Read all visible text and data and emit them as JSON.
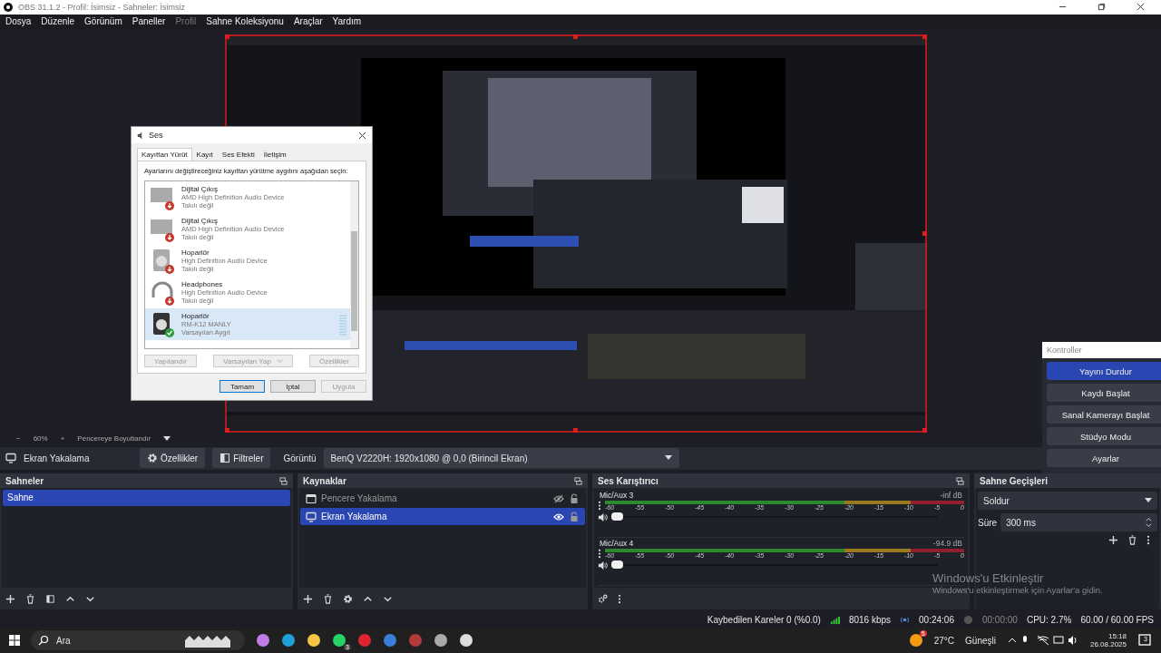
{
  "window": {
    "title": "OBS 31.1.2 - Profil: İsimsiz - Sahneler: İsimsiz"
  },
  "menu": [
    {
      "label": "Dosya",
      "disabled": false
    },
    {
      "label": "Düzenle",
      "disabled": false
    },
    {
      "label": "Görünüm",
      "disabled": false
    },
    {
      "label": "Paneller",
      "disabled": false
    },
    {
      "label": "Profil",
      "disabled": true
    },
    {
      "label": "Sahne Koleksiyonu",
      "disabled": false
    },
    {
      "label": "Araçlar",
      "disabled": false
    },
    {
      "label": "Yardım",
      "disabled": false
    }
  ],
  "zoom_bar": {
    "minus": "−",
    "zoom": "60%",
    "plus": "+",
    "fit": "Pencereye Boyutlandır"
  },
  "source_toolbar": {
    "source": "Ekran Yakalama",
    "properties": "Özellikler",
    "filters": "Filtreler",
    "display_label": "Görüntü",
    "display": "BenQ V2220H: 1920x1080 @ 0,0 (Birincil Ekran)"
  },
  "scenes": {
    "title": "Sahneler",
    "items": [
      {
        "name": "Sahne",
        "selected": true
      }
    ]
  },
  "sources": {
    "title": "Kaynaklar",
    "items": [
      {
        "name": "Pencere Yakalama",
        "kind": "window",
        "selected": false,
        "visible": false
      },
      {
        "name": "Ekran Yakalama",
        "kind": "display",
        "selected": true,
        "visible": true
      }
    ]
  },
  "mixer": {
    "title": "Ses Karıştırıcı",
    "channels": [
      {
        "name": "Mic/Aux 3",
        "reading": "-inf dB",
        "level": 0,
        "scale": [
          "-60",
          "-55",
          "-50",
          "-45",
          "-40",
          "-35",
          "-30",
          "-25",
          "-20",
          "-15",
          "-10",
          "-5",
          "0"
        ]
      },
      {
        "name": "Mic/Aux 4",
        "reading": "-94.9 dB",
        "level": 0,
        "scale": [
          "-60",
          "-55",
          "-50",
          "-45",
          "-40",
          "-35",
          "-30",
          "-25",
          "-20",
          "-15",
          "-10",
          "-5",
          "0"
        ]
      }
    ]
  },
  "transitions": {
    "title": "Sahne Geçişleri",
    "transition": "Soldur",
    "duration_label": "Süre",
    "duration": "300 ms"
  },
  "controls": {
    "title": "Kontroller",
    "buttons": [
      {
        "label": "Yayını Durdur",
        "active": true
      },
      {
        "label": "Kaydı Başlat",
        "active": false
      },
      {
        "label": "Sanal Kamerayı Başlat",
        "active": false
      },
      {
        "label": "Stüdyo Modu",
        "active": false
      },
      {
        "label": "Ayarlar",
        "active": false
      }
    ]
  },
  "sound_dialog": {
    "title": "Ses",
    "tabs": [
      {
        "label": "Kayıttan Yürüt",
        "selected": true
      },
      {
        "label": "Kayıt",
        "selected": false
      },
      {
        "label": "Ses Efekti",
        "selected": false
      },
      {
        "label": "İletişim",
        "selected": false
      }
    ],
    "instruction": "Ayarlarını değiştireceğiniz kayıttan yürütme aygıtını aşağıdan seçin:",
    "devices": [
      {
        "name": "Dijital Çıkış",
        "description": "AMD High Definition Audio Device",
        "status": "Takılı değil",
        "kind": "monitor",
        "selected": false,
        "default": false
      },
      {
        "name": "Dijital Çıkış",
        "description": "AMD High Definition Audio Device",
        "status": "Takılı değil",
        "kind": "monitor",
        "selected": false,
        "default": false
      },
      {
        "name": "Hoparlör",
        "description": "High Definition Audio Device",
        "status": "Takılı değil",
        "kind": "speaker",
        "selected": false,
        "default": false
      },
      {
        "name": "Headphones",
        "description": "High Definition Audio Device",
        "status": "Takılı değil",
        "kind": "headphones",
        "selected": false,
        "default": false
      },
      {
        "name": "Hoparlör",
        "description": "RM-K12 MANLY",
        "status": "Varsayılan Aygıt",
        "kind": "speaker",
        "selected": true,
        "default": true
      }
    ],
    "buttons": [
      {
        "label": "Yapılandır",
        "disabled": true,
        "kind": "plain"
      },
      {
        "label": "Varsayılan Yap",
        "disabled": true,
        "kind": "split"
      },
      {
        "label": "Özellikler",
        "disabled": true,
        "kind": "plain"
      }
    ],
    "footer": [
      {
        "label": "Tamam",
        "disabled": false
      },
      {
        "label": "İptal",
        "disabled": false
      },
      {
        "label": "Uygula",
        "disabled": true
      }
    ]
  },
  "activation": {
    "title": "Windows'u Etkinleştir",
    "text": "Windows'u etkinleştirmek için Ayarlar'a gidin."
  },
  "status_bar": {
    "dropped": "Kaybedilen Kareler 0 (%0.0)",
    "bitrate": "8016 kbps",
    "stream_time": "00:24:06",
    "record_time": "00:00:00",
    "cpu": "CPU: 2.7%",
    "fps": "60.00 / 60.00 FPS"
  },
  "taskbar": {
    "search": "Ara",
    "apps": [
      {
        "kind": "copilot"
      },
      {
        "kind": "edge"
      },
      {
        "kind": "folder"
      },
      {
        "kind": "whatsapp",
        "badge": "3"
      },
      {
        "kind": "opera"
      },
      {
        "kind": "globe"
      },
      {
        "kind": "game"
      },
      {
        "kind": "gauge"
      },
      {
        "kind": "obs"
      }
    ],
    "weather_badge": "5",
    "temperature": "27°C",
    "weather": "Güneşli",
    "time": "15:18",
    "date": "26.08.2025",
    "notifications": "3"
  }
}
